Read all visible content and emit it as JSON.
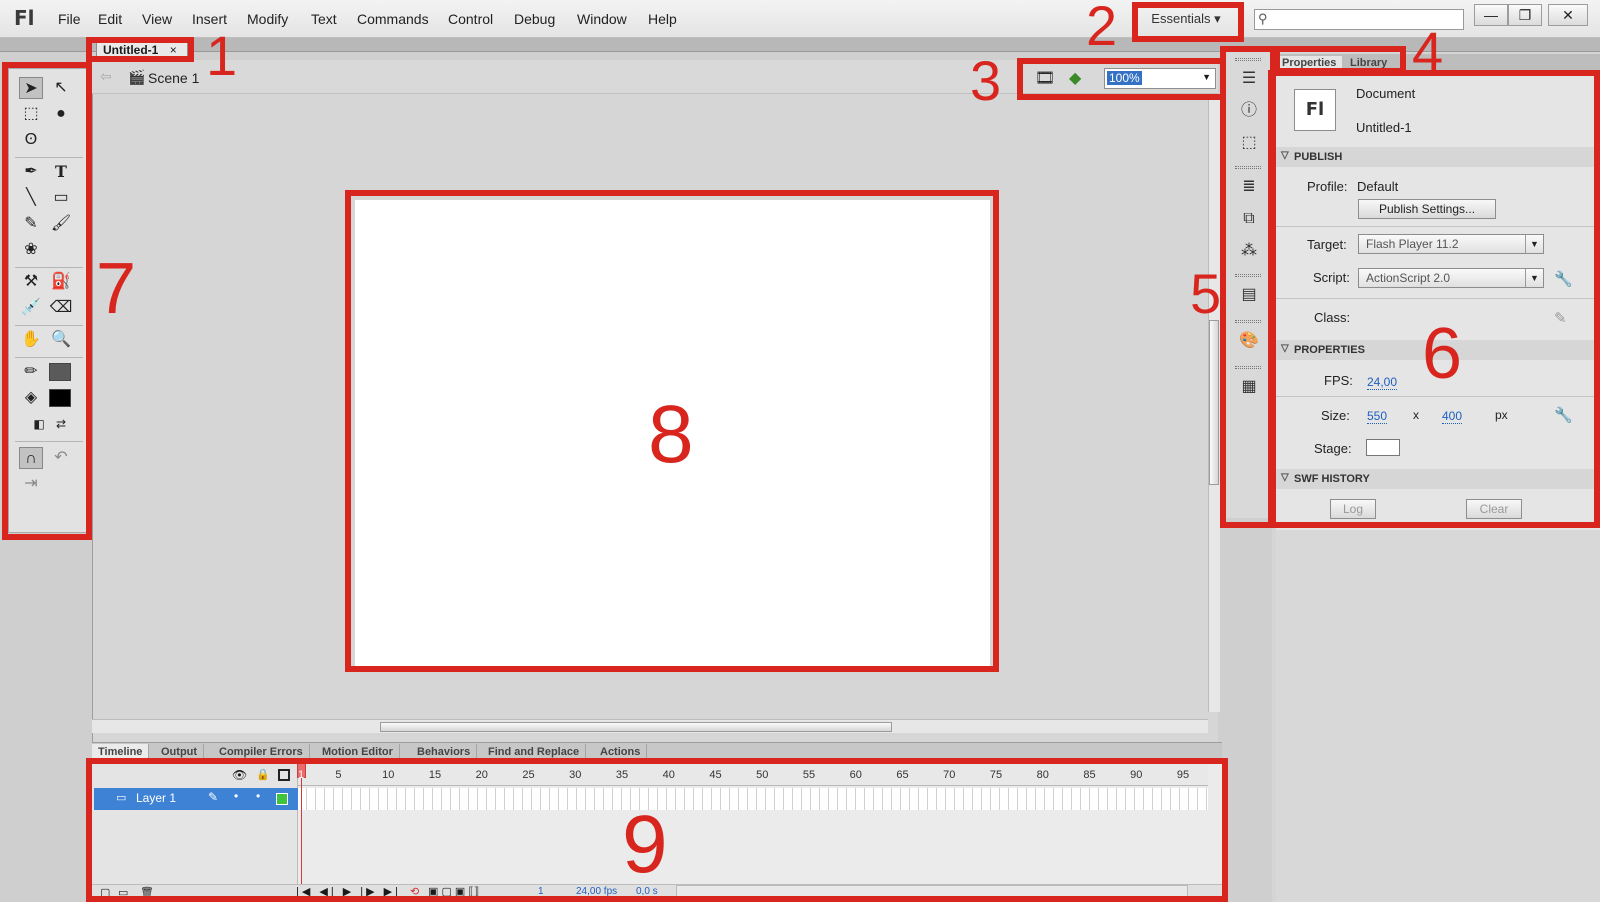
{
  "app": {
    "logo": "Fl",
    "menu": [
      "File",
      "Edit",
      "View",
      "Insert",
      "Modify",
      "Text",
      "Commands",
      "Control",
      "Debug",
      "Window",
      "Help"
    ],
    "workspace": "Essentials ▾",
    "search_placeholder": "",
    "win_controls": [
      "—",
      "❐",
      "✕"
    ]
  },
  "document": {
    "tab_label": "Untitled-1",
    "tab_close": "×",
    "scene": "Scene 1",
    "zoom": "100%"
  },
  "properties": {
    "tabs": [
      "Properties",
      "Library"
    ],
    "doc_type": "Document",
    "doc_name": "Untitled-1",
    "icon_text": "Fl",
    "publish": {
      "header": "PUBLISH",
      "profile_label": "Profile:",
      "profile_value": "Default",
      "settings_button": "Publish Settings...",
      "target_label": "Target:",
      "target_value": "Flash Player 11.2",
      "script_label": "Script:",
      "script_value": "ActionScript 2.0",
      "class_label": "Class:"
    },
    "props": {
      "header": "PROPERTIES",
      "fps_label": "FPS:",
      "fps_value": "24,00",
      "size_label": "Size:",
      "width": "550",
      "x": "x",
      "height": "400",
      "unit": "px",
      "stage_label": "Stage:",
      "stage_color": "#ffffff"
    },
    "history": {
      "header": "SWF HISTORY",
      "log_button": "Log",
      "clear_button": "Clear"
    }
  },
  "bottom_tabs": [
    "Timeline",
    "Output",
    "Compiler Errors",
    "Motion Editor",
    "Behaviors",
    "Find and Replace",
    "Actions"
  ],
  "timeline": {
    "layer": "Layer 1",
    "frame_numbers": [
      "1",
      "5",
      "10",
      "15",
      "20",
      "25",
      "30",
      "35",
      "40",
      "45",
      "50",
      "55",
      "60",
      "65",
      "70",
      "75",
      "80",
      "85",
      "90",
      "95"
    ],
    "current_frame": "1",
    "fps_status": "24,00 fps",
    "time_status": "0,0 s"
  },
  "annotations": [
    "1",
    "2",
    "3",
    "4",
    "5",
    "6",
    "7",
    "8",
    "9"
  ],
  "colors": {
    "annotation": "#d8261e",
    "layer_selected": "#3e82d6",
    "stage": "#ffffff"
  }
}
